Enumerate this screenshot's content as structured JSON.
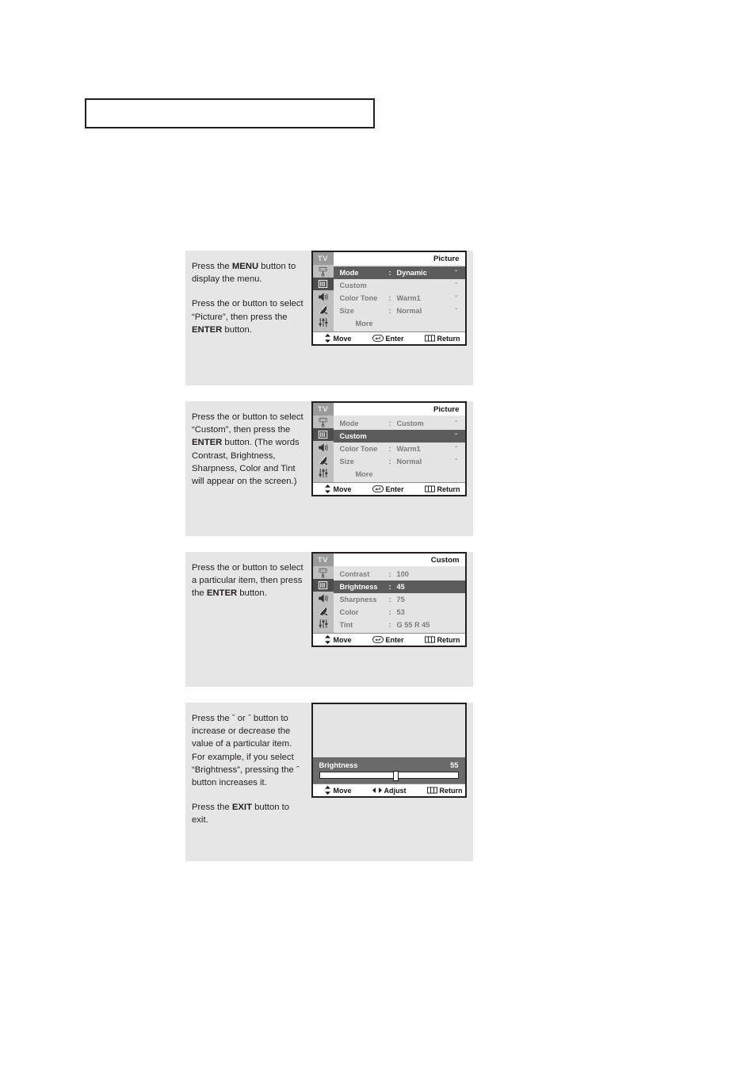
{
  "page": {
    "title_box_text": ""
  },
  "colors": {
    "panel_bg": "#e6e6e6",
    "osd_body_bg": "#e4e4e4",
    "osd_sidebar_bg": "#bfbfbf",
    "osd_highlight": "#5c5c5c",
    "osd_tv_badge": "#9a9a9a",
    "osd_text_dim": "#7c7c7c",
    "slider_bg": "#6b6b6b",
    "outline": "#231f20"
  },
  "footer_common": {
    "move": "Move",
    "enter": "Enter",
    "return": "Return",
    "adjust": "Adjust"
  },
  "sidebar_icons": [
    {
      "name": "input-jack-icon",
      "active": false
    },
    {
      "name": "picture-screen-icon",
      "active": true
    },
    {
      "name": "sound-speaker-icon",
      "active": false
    },
    {
      "name": "channel-satellite-dish-icon",
      "active": false
    },
    {
      "name": "setup-sliders-icon",
      "active": false
    }
  ],
  "panels": [
    {
      "id": "panel-1",
      "text_blocks": [
        {
          "runs": [
            {
              "t": "Press the ",
              "b": false
            },
            {
              "t": "MENU",
              "b": true
            },
            {
              "t": " button to display the menu.",
              "b": false
            }
          ],
          "gap": false
        },
        {
          "runs": [
            {
              "t": "Press the     or     button to select “Picture”, then press the ",
              "b": false
            },
            {
              "t": "ENTER",
              "b": true
            },
            {
              "t": " button.",
              "b": false
            }
          ],
          "gap": true
        }
      ],
      "osd": {
        "tv_label": "TV",
        "title": "Picture",
        "rows": [
          {
            "label": "Mode",
            "colon": ":",
            "value": "Dynamic",
            "arrow": "ˇ",
            "selected": true,
            "more": false
          },
          {
            "label": "Custom",
            "colon": "",
            "value": "",
            "arrow": "ˇ",
            "selected": false,
            "more": false
          },
          {
            "label": "Color Tone",
            "colon": ":",
            "value": "Warm1",
            "arrow": "ˇ",
            "selected": false,
            "more": false
          },
          {
            "label": "Size",
            "colon": ":",
            "value": "Normal",
            "arrow": "ˇ",
            "selected": false,
            "more": false
          },
          {
            "label": "More",
            "colon": "",
            "value": "",
            "arrow": "",
            "selected": false,
            "more": true
          }
        ],
        "footer": [
          {
            "icon": "updown-arrows-icon",
            "label": "Move"
          },
          {
            "icon": "enter-key-icon",
            "label": "Enter"
          },
          {
            "icon": "menu-bars-icon",
            "label": "Return"
          }
        ]
      }
    },
    {
      "id": "panel-2",
      "text_blocks": [
        {
          "runs": [
            {
              "t": "Press the     or     button to select “Custom”, then press the ",
              "b": false
            },
            {
              "t": "ENTER",
              "b": true
            },
            {
              "t": " button. (The words Contrast, Brightness, Sharpness, Color and Tint will appear on the screen.)",
              "b": false
            }
          ],
          "gap": false
        }
      ],
      "osd": {
        "tv_label": "TV",
        "title": "Picture",
        "rows": [
          {
            "label": "Mode",
            "colon": ":",
            "value": "Custom",
            "arrow": "ˇ",
            "selected": false,
            "more": false
          },
          {
            "label": "Custom",
            "colon": "",
            "value": "",
            "arrow": "ˇ",
            "selected": true,
            "more": false
          },
          {
            "label": "Color Tone",
            "colon": ":",
            "value": "Warm1",
            "arrow": "ˇ",
            "selected": false,
            "more": false
          },
          {
            "label": "Size",
            "colon": ":",
            "value": "Normal",
            "arrow": "ˇ",
            "selected": false,
            "more": false
          },
          {
            "label": "More",
            "colon": "",
            "value": "",
            "arrow": "",
            "selected": false,
            "more": true
          }
        ],
        "footer": [
          {
            "icon": "updown-arrows-icon",
            "label": "Move"
          },
          {
            "icon": "enter-key-icon",
            "label": "Enter"
          },
          {
            "icon": "menu-bars-icon",
            "label": "Return"
          }
        ]
      }
    },
    {
      "id": "panel-3",
      "text_blocks": [
        {
          "runs": [
            {
              "t": "Press the     or     button to select a particular item, then press the ",
              "b": false
            },
            {
              "t": "ENTER",
              "b": true
            },
            {
              "t": " button.",
              "b": false
            }
          ],
          "gap": false
        }
      ],
      "osd": {
        "tv_label": "TV",
        "title": "Custom",
        "rows": [
          {
            "label": "Contrast",
            "colon": ":",
            "value": "100",
            "arrow": "",
            "selected": false,
            "more": false
          },
          {
            "label": "Brightness",
            "colon": ":",
            "value": "45",
            "arrow": "",
            "selected": true,
            "more": false
          },
          {
            "label": "Sharpness",
            "colon": ":",
            "value": "75",
            "arrow": "",
            "selected": false,
            "more": false
          },
          {
            "label": "Color",
            "colon": ":",
            "value": "53",
            "arrow": "",
            "selected": false,
            "more": false
          },
          {
            "label": "Tint",
            "colon": ":",
            "value": "G 55  R 45",
            "arrow": "",
            "selected": false,
            "more": false
          }
        ],
        "footer": [
          {
            "icon": "updown-arrows-icon",
            "label": "Move"
          },
          {
            "icon": "enter-key-icon",
            "label": "Enter"
          },
          {
            "icon": "menu-bars-icon",
            "label": "Return"
          }
        ]
      }
    },
    {
      "id": "panel-4",
      "text_blocks": [
        {
          "runs": [
            {
              "t": "Press the ",
              "b": false
            },
            {
              "t": "ˇ",
              "b": false
            },
            {
              "t": " or ",
              "b": false
            },
            {
              "t": "ˆ",
              "b": false
            },
            {
              "t": " button to increase or decrease the value of a particular item.",
              "b": false
            }
          ],
          "gap": false
        },
        {
          "runs": [
            {
              "t": "For example, if you select “Brightness”, pressing the ",
              "b": false
            },
            {
              "t": "ˆ",
              "b": false
            },
            {
              "t": " button increases it.",
              "b": false
            }
          ],
          "gap": false
        },
        {
          "runs": [
            {
              "t": "Press the ",
              "b": false
            },
            {
              "t": "EXIT",
              "b": true
            },
            {
              "t": " button to exit.",
              "b": false
            }
          ],
          "gap": true
        }
      ],
      "slider": {
        "label": "Brightness",
        "value": "55",
        "percent": 55,
        "footer": [
          {
            "icon": "updown-arrows-icon",
            "label": "Move"
          },
          {
            "icon": "leftright-arrows-icon",
            "label": "Adjust"
          },
          {
            "icon": "menu-bars-icon",
            "label": "Return"
          }
        ]
      }
    }
  ]
}
